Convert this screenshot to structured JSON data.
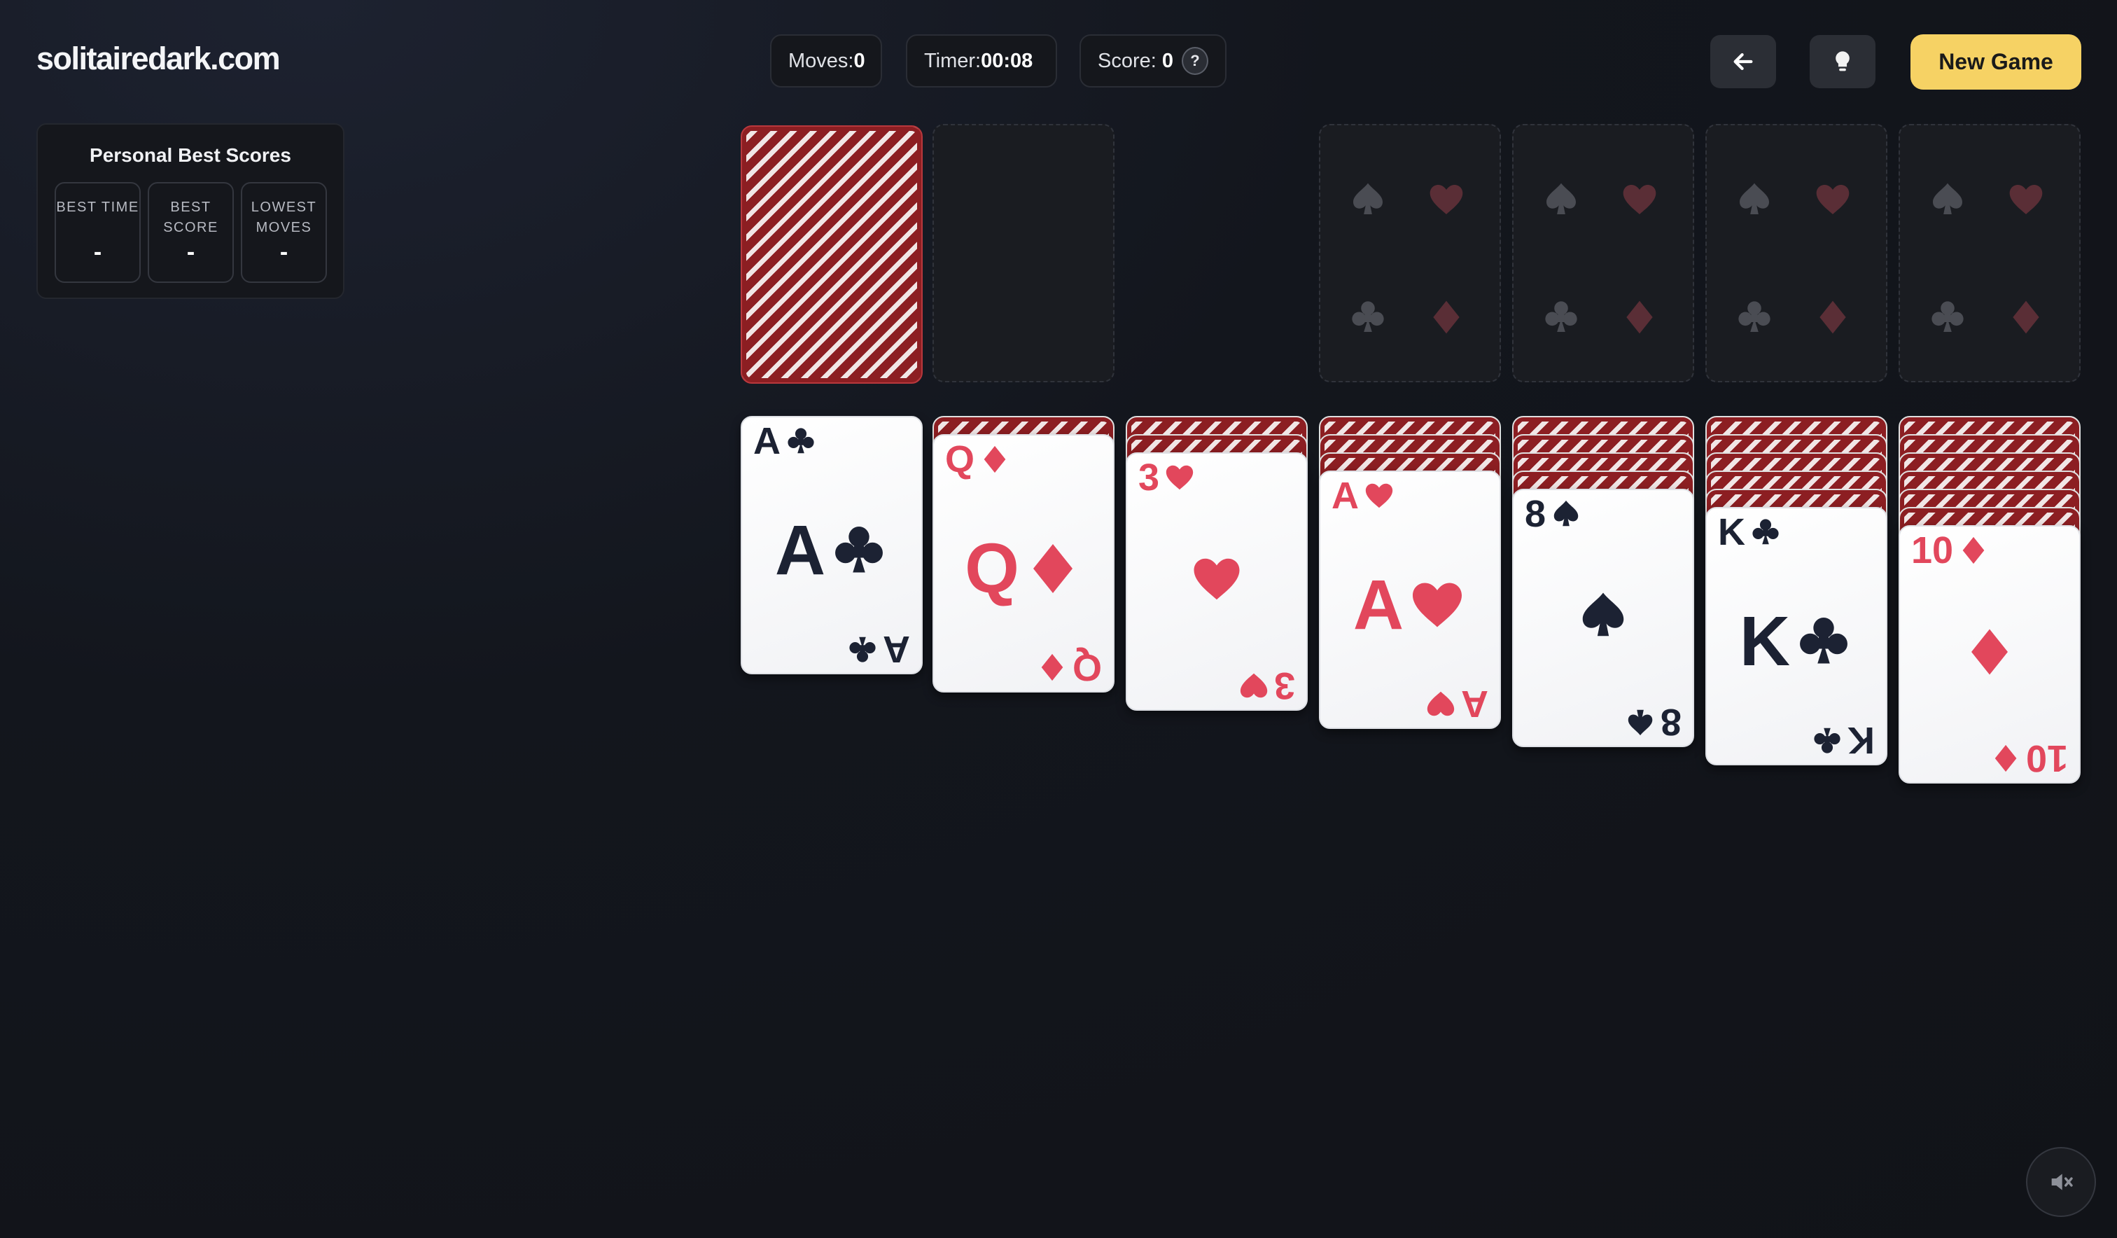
{
  "site": {
    "logo": "solitairedark.com"
  },
  "stats": {
    "moves_label": "Moves:",
    "moves_value": "0",
    "timer_label": "Timer:",
    "timer_value": "00:08",
    "score_label": "Score:",
    "score_value": "0",
    "help_glyph": "?"
  },
  "toolbar": {
    "undo_icon": "arrow-left-icon",
    "hint_icon": "lightbulb-icon",
    "new_game_label": "New Game"
  },
  "best_scores": {
    "title": "Personal Best Scores",
    "items": [
      {
        "label": "BEST TIME",
        "value": "-"
      },
      {
        "label": "BEST SCORE",
        "value": "-"
      },
      {
        "label": "LOWEST MOVES",
        "value": "-"
      }
    ]
  },
  "colors": {
    "red_suit": "#e2475c",
    "black_suit": "#1c2233",
    "card_back": "#8c1e22",
    "new_game_bg": "#f6d264"
  },
  "stock": {
    "face_down": true
  },
  "foundations": [
    {
      "cards": 0
    },
    {
      "cards": 0
    },
    {
      "cards": 0
    },
    {
      "cards": 0
    }
  ],
  "tableau": [
    {
      "hidden": 0,
      "top": {
        "rank": "A",
        "suit": "clubs",
        "color": "black"
      }
    },
    {
      "hidden": 1,
      "top": {
        "rank": "Q",
        "suit": "diamonds",
        "color": "red"
      }
    },
    {
      "hidden": 2,
      "top": {
        "rank": "3",
        "suit": "hearts",
        "color": "red"
      }
    },
    {
      "hidden": 3,
      "top": {
        "rank": "A",
        "suit": "hearts",
        "color": "red"
      }
    },
    {
      "hidden": 4,
      "top": {
        "rank": "8",
        "suit": "spades",
        "color": "black"
      }
    },
    {
      "hidden": 5,
      "top": {
        "rank": "K",
        "suit": "clubs",
        "color": "black"
      }
    },
    {
      "hidden": 6,
      "top": {
        "rank": "10",
        "suit": "diamonds",
        "color": "red"
      }
    }
  ],
  "sound": {
    "icon": "speaker-muted-icon"
  }
}
